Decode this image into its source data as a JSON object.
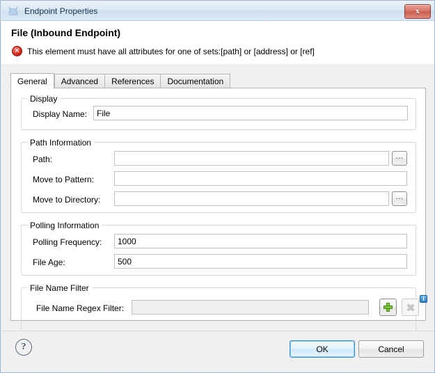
{
  "window": {
    "title": "Endpoint Properties",
    "icon": "endpoint-icon",
    "close_label": "x"
  },
  "header": {
    "title": "File (Inbound Endpoint)",
    "status_icon": "error-icon",
    "status_glyph": "✕",
    "message": "This element must have all attributes for one of sets:[path] or [address] or [ref]"
  },
  "tabs": [
    {
      "label": "General",
      "selected": true
    },
    {
      "label": "Advanced",
      "selected": false
    },
    {
      "label": "References",
      "selected": false
    },
    {
      "label": "Documentation",
      "selected": false
    }
  ],
  "groups": {
    "display": {
      "legend": "Display",
      "fields": [
        {
          "label": "Display Name:",
          "value": "File",
          "placeholder": ""
        }
      ]
    },
    "path_information": {
      "legend": "Path Information",
      "fields": [
        {
          "label": "Path:",
          "value": "",
          "placeholder": "",
          "browse": "..."
        },
        {
          "label": "Move to Pattern:",
          "value": "",
          "placeholder": ""
        },
        {
          "label": "Move to Directory:",
          "value": "",
          "placeholder": "",
          "browse": "..."
        }
      ]
    },
    "polling_information": {
      "legend": "Polling Information",
      "fields": [
        {
          "label": "Polling Frequency:",
          "value": "1000",
          "placeholder": ""
        },
        {
          "label": "File Age:",
          "value": "500",
          "placeholder": ""
        }
      ]
    },
    "file_name_filter": {
      "legend": "File Name Filter",
      "fields": [
        {
          "label": "File Name Regex Filter:",
          "value": "",
          "placeholder": "",
          "disabled": true
        }
      ],
      "add_button": "+",
      "remove_button": "×",
      "info_badge": "i"
    }
  },
  "footer": {
    "help_label": "?",
    "ok_label": "OK",
    "cancel_label": "Cancel"
  },
  "colors": {
    "accent": "#3c93cc",
    "error": "#d93224",
    "add": "#7ec13d",
    "info": "#2a7fc4",
    "titlebar": "#dce9f5"
  }
}
